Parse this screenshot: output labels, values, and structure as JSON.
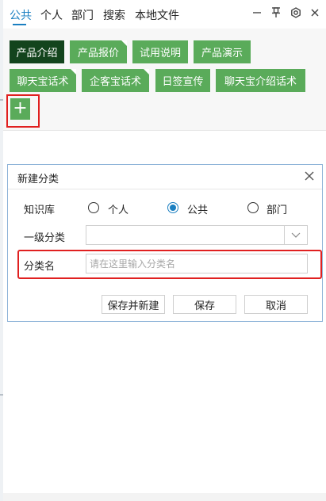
{
  "tabs": [
    {
      "label": "公共",
      "active": true
    },
    {
      "label": "个人",
      "active": false
    },
    {
      "label": "部门",
      "active": false
    },
    {
      "label": "搜索",
      "active": false
    },
    {
      "label": "本地文件",
      "active": false
    }
  ],
  "window_icons": [
    "minimize-icon",
    "pin-icon",
    "settings-icon",
    "close-icon"
  ],
  "categories": [
    {
      "label": "产品介绍",
      "selected": true
    },
    {
      "label": "产品报价",
      "selected": false
    },
    {
      "label": "试用说明",
      "selected": false
    },
    {
      "label": "产品演示",
      "selected": false
    },
    {
      "label": "聊天宝话术",
      "selected": false
    },
    {
      "label": "企客宝话术",
      "selected": false
    },
    {
      "label": "日签宣传",
      "selected": false
    },
    {
      "label": "聊天宝介绍话术",
      "selected": false
    }
  ],
  "add_button_label": "+",
  "dialog": {
    "title": "新建分类",
    "knowledge_label": "知识库",
    "radio_options": [
      {
        "label": "个人",
        "checked": false
      },
      {
        "label": "公共",
        "checked": true
      },
      {
        "label": "部门",
        "checked": false
      }
    ],
    "level1_label": "一级分类",
    "level1_value": "",
    "name_label": "分类名",
    "name_placeholder": "请在这里输入分类名",
    "buttons": {
      "save_new": "保存并新建",
      "save": "保存",
      "cancel": "取消"
    }
  },
  "colors": {
    "accent": "#1a7fc1",
    "category_green": "#5aab5a",
    "category_selected": "#13441d",
    "highlight_red": "#e02020"
  }
}
